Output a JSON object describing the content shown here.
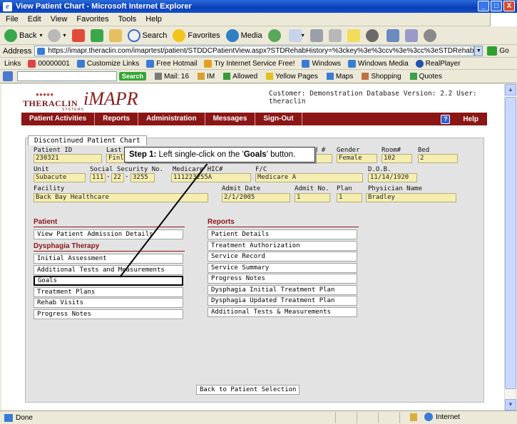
{
  "window": {
    "title": "View Patient Chart - Microsoft Internet Explorer",
    "min": "_",
    "max": "□",
    "close": "X"
  },
  "menu": [
    "File",
    "Edit",
    "View",
    "Favorites",
    "Tools",
    "Help"
  ],
  "toolbar": {
    "back": "Back",
    "search": "Search",
    "favorites": "Favorites",
    "media": "Media"
  },
  "address": {
    "label": "Address",
    "url": "https://imapr.theraclin.com/imaprtest/patient/STDDCPatientView.aspx?STDRehabHistory=%3ckey%3e%3ccv%3e%3cc%3eSTDRehabHistoryID%",
    "go": "Go"
  },
  "links": {
    "label": "Links",
    "items": [
      "00000001",
      "Customize Links",
      "Free Hotmail",
      "Try Internet Service Free!",
      "Windows",
      "Windows Media",
      "RealPlayer"
    ]
  },
  "searchbar": {
    "search_btn": "Search",
    "items": [
      "Mail: 16",
      "IM",
      "Allowed",
      "Yellow Pages",
      "Maps",
      "Shopping",
      "Quotes"
    ]
  },
  "app": {
    "logo_text": "THERACLIN",
    "logo_systems": "SYSTEMS",
    "logo_brand": "iMAPR",
    "customer": "Customer: Demonstration Database Version: 2.2 User: theraclin",
    "nav": [
      "Patient Activities",
      "Reports",
      "Administration",
      "Messages",
      "Sign-Out"
    ],
    "help": "Help",
    "tab": "Discontinued Patient Chart"
  },
  "patient": {
    "labels": {
      "patient_id": "Patient ID",
      "last": "Last",
      "mr": "d #",
      "gender": "Gender",
      "room": "Room#",
      "bed": "Bed",
      "unit": "Unit",
      "ssn": "Social Security No.",
      "medicare": "Medicare HIC#",
      "fc": "F/C",
      "dob": "D.O.B.",
      "facility": "Facility",
      "admit_date": "Admit Date",
      "admit_no": "Admit No.",
      "plan": "Plan",
      "physician": "Physician Name"
    },
    "values": {
      "patient_id": "230321",
      "last": "Finle",
      "gender": "Female",
      "room": "102",
      "bed": "2",
      "unit": "Subacute",
      "ssn1": "111",
      "ssn2": "22",
      "ssn3": "3255",
      "medicare": "111223255A",
      "fc": "Medicare A",
      "dob": "11/14/1920",
      "facility": "Back Bay Healthcare",
      "admit_date": "2/1/2005",
      "admit_no": "1",
      "plan": "1",
      "physician": "Bradley"
    }
  },
  "left": {
    "patient_title": "Patient",
    "patient_items": [
      "View Patient Admission Details"
    ],
    "dysphagia_title": "Dysphagia Therapy",
    "dysphagia_items": [
      "Initial Assessment",
      "Additional Tests and Measurements",
      "Goals",
      "Treatment Plans",
      "Rehab Visits",
      "Progress Notes"
    ]
  },
  "reports": {
    "title": "Reports",
    "items": [
      "Patient Details",
      "Treatment Authorization",
      "Service Record",
      "Service Summary",
      "Progress Notes",
      "Dysphagia Initial Treatment Plan",
      "Dysphagia Updated Treatment Plan",
      "Additional Tests & Measurements"
    ]
  },
  "back_btn": "Back to Patient Selection",
  "callout": {
    "step": "Step 1:",
    "pre": " Left single-click on the '",
    "bold": "Goals",
    "post": "' button."
  },
  "status": {
    "done": "Done",
    "zone": "Internet"
  }
}
